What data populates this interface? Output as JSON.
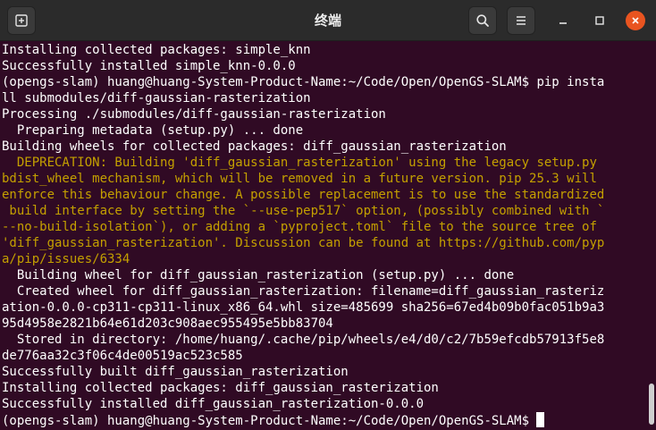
{
  "window": {
    "title": "终端"
  },
  "titlebar_icons": {
    "new_tab": "new-tab-icon",
    "search": "search-icon",
    "menu": "hamburger-menu-icon",
    "minimize": "minimize-icon",
    "maximize": "maximize-icon",
    "close": "close-icon"
  },
  "colors": {
    "terminal_bg": "#300a24",
    "text": "#ffffff",
    "warning": "#c4a000",
    "titlebar_bg": "#2b2b2b",
    "close_button": "#e95420"
  },
  "terminal": {
    "lines": [
      {
        "text": "Installing collected packages: simple_knn",
        "style": "normal"
      },
      {
        "text": "Successfully installed simple_knn-0.0.0",
        "style": "normal"
      },
      {
        "text": "(opengs-slam) huang@huang-System-Product-Name:~/Code/Open/OpenGS-SLAM$ pip insta",
        "style": "normal"
      },
      {
        "text": "ll submodules/diff-gaussian-rasterization",
        "style": "normal"
      },
      {
        "text": "Processing ./submodules/diff-gaussian-rasterization",
        "style": "normal"
      },
      {
        "text": "  Preparing metadata (setup.py) ... done",
        "style": "normal"
      },
      {
        "text": "Building wheels for collected packages: diff_gaussian_rasterization",
        "style": "normal"
      },
      {
        "text": "  DEPRECATION: Building 'diff_gaussian_rasterization' using the legacy setup.py",
        "style": "warn"
      },
      {
        "text": "bdist_wheel mechanism, which will be removed in a future version. pip 25.3 will",
        "style": "warn"
      },
      {
        "text": "enforce this behaviour change. A possible replacement is to use the standardized",
        "style": "warn"
      },
      {
        "text": " build interface by setting the `--use-pep517` option, (possibly combined with `",
        "style": "warn"
      },
      {
        "text": "--no-build-isolation`), or adding a `pyproject.toml` file to the source tree of",
        "style": "warn"
      },
      {
        "text": "'diff_gaussian_rasterization'. Discussion can be found at https://github.com/pyp",
        "style": "warn"
      },
      {
        "text": "a/pip/issues/6334",
        "style": "warn"
      },
      {
        "text": "  Building wheel for diff_gaussian_rasterization (setup.py) ... done",
        "style": "normal"
      },
      {
        "text": "  Created wheel for diff_gaussian_rasterization: filename=diff_gaussian_rasteriz",
        "style": "normal"
      },
      {
        "text": "ation-0.0.0-cp311-cp311-linux_x86_64.whl size=485699 sha256=67ed4b09b0fac051b9a3",
        "style": "normal"
      },
      {
        "text": "95d4958e2821b64e61d203c908aec955495e5bb83704",
        "style": "normal"
      },
      {
        "text": "  Stored in directory: /home/huang/.cache/pip/wheels/e4/d0/c2/7b59efcdb57913f5e8",
        "style": "normal"
      },
      {
        "text": "de776aa32c3f06c4de00519ac523c585",
        "style": "normal"
      },
      {
        "text": "Successfully built diff_gaussian_rasterization",
        "style": "normal"
      },
      {
        "text": "Installing collected packages: diff_gaussian_rasterization",
        "style": "normal"
      },
      {
        "text": "Successfully installed diff_gaussian_rasterization-0.0.0",
        "style": "normal"
      }
    ],
    "prompt": "(opengs-slam) huang@huang-System-Product-Name:~/Code/Open/OpenGS-SLAM$"
  }
}
